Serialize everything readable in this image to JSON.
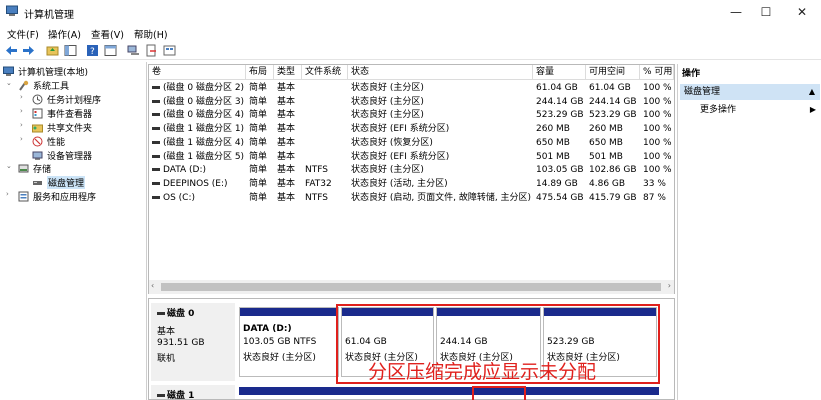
{
  "window": {
    "title": "计算机管理",
    "minimize_glyph": "—",
    "maximize_glyph": "☐",
    "close_glyph": "✕"
  },
  "menu": [
    "文件(F)",
    "操作(A)",
    "查看(V)",
    "帮助(H)"
  ],
  "toolbar_icons": [
    "back-icon",
    "forward-icon",
    "up-folder-icon",
    "show-hide-tree-icon",
    "help-icon",
    "properties-icon",
    "connect-icon",
    "export-icon",
    "view-icon"
  ],
  "tree": [
    {
      "label": "计算机管理(本地)",
      "icon": "computer-icon",
      "arrow": ""
    },
    {
      "label": "系统工具",
      "icon": "tools-icon",
      "arrow": "⌄"
    },
    {
      "label": "任务计划程序",
      "icon": "clock-icon",
      "arrow": "›"
    },
    {
      "label": "事件查看器",
      "icon": "event-viewer-icon",
      "arrow": "›"
    },
    {
      "label": "共享文件夹",
      "icon": "shared-folder-icon",
      "arrow": "›"
    },
    {
      "label": "性能",
      "icon": "performance-icon",
      "arrow": "›"
    },
    {
      "label": "设备管理器",
      "icon": "device-manager-icon",
      "arrow": ""
    },
    {
      "label": "存储",
      "icon": "storage-icon",
      "arrow": "⌄"
    },
    {
      "label": "磁盘管理",
      "icon": "disk-icon",
      "arrow": ""
    },
    {
      "label": "服务和应用程序",
      "icon": "services-icon",
      "arrow": "›"
    }
  ],
  "volume_columns": [
    "卷",
    "布局",
    "类型",
    "文件系统",
    "状态",
    "容量",
    "可用空间",
    "% 可用"
  ],
  "volumes": [
    [
      "(磁盘 0 磁盘分区 2)",
      "简单",
      "基本",
      "",
      "状态良好 (主分区)",
      "61.04 GB",
      "61.04 GB",
      "100 %"
    ],
    [
      "(磁盘 0 磁盘分区 3)",
      "简单",
      "基本",
      "",
      "状态良好 (主分区)",
      "244.14 GB",
      "244.14 GB",
      "100 %"
    ],
    [
      "(磁盘 0 磁盘分区 4)",
      "简单",
      "基本",
      "",
      "状态良好 (主分区)",
      "523.29 GB",
      "523.29 GB",
      "100 %"
    ],
    [
      "(磁盘 1 磁盘分区 1)",
      "简单",
      "基本",
      "",
      "状态良好 (EFI 系统分区)",
      "260 MB",
      "260 MB",
      "100 %"
    ],
    [
      "(磁盘 1 磁盘分区 4)",
      "简单",
      "基本",
      "",
      "状态良好 (恢复分区)",
      "650 MB",
      "650 MB",
      "100 %"
    ],
    [
      "(磁盘 1 磁盘分区 5)",
      "简单",
      "基本",
      "",
      "状态良好 (EFI 系统分区)",
      "501 MB",
      "501 MB",
      "100 %"
    ],
    [
      "DATA (D:)",
      "简单",
      "基本",
      "NTFS",
      "状态良好 (主分区)",
      "103.05 GB",
      "102.86 GB",
      "100 %"
    ],
    [
      "DEEPINOS (E:)",
      "简单",
      "基本",
      "FAT32",
      "状态良好 (活动, 主分区)",
      "14.89 GB",
      "4.86 GB",
      "33 %"
    ],
    [
      "OS (C:)",
      "简单",
      "基本",
      "NTFS",
      "状态良好 (启动, 页面文件, 故障转储, 主分区)",
      "475.54 GB",
      "415.79 GB",
      "87 %"
    ]
  ],
  "scroll": {
    "left": "‹",
    "right": "›"
  },
  "disks": [
    {
      "name": "磁盘 0",
      "type": "基本",
      "size": "931.51 GB",
      "status": "联机",
      "partitions": [
        {
          "title": "DATA  (D:)",
          "detail": "103.05 GB NTFS",
          "status": "状态良好 (主分区)"
        },
        {
          "title": "",
          "detail": "61.04 GB",
          "status": "状态良好 (主分区)"
        },
        {
          "title": "",
          "detail": "244.14 GB",
          "status": "状态良好 (主分区)"
        },
        {
          "title": "",
          "detail": "523.29 GB",
          "status": "状态良好 (主分区)"
        }
      ]
    },
    {
      "name": "磁盘 1"
    }
  ],
  "annotation": "分区压缩完成应显示未分配",
  "actions": {
    "header": "操作",
    "section": "磁盘管理",
    "section_caret": "▲",
    "item": "更多操作",
    "item_caret": "▶"
  },
  "colors": {
    "partition_bar": "#1a2a8c",
    "annotation": "#e0201c",
    "selection": "#cce4f7"
  }
}
